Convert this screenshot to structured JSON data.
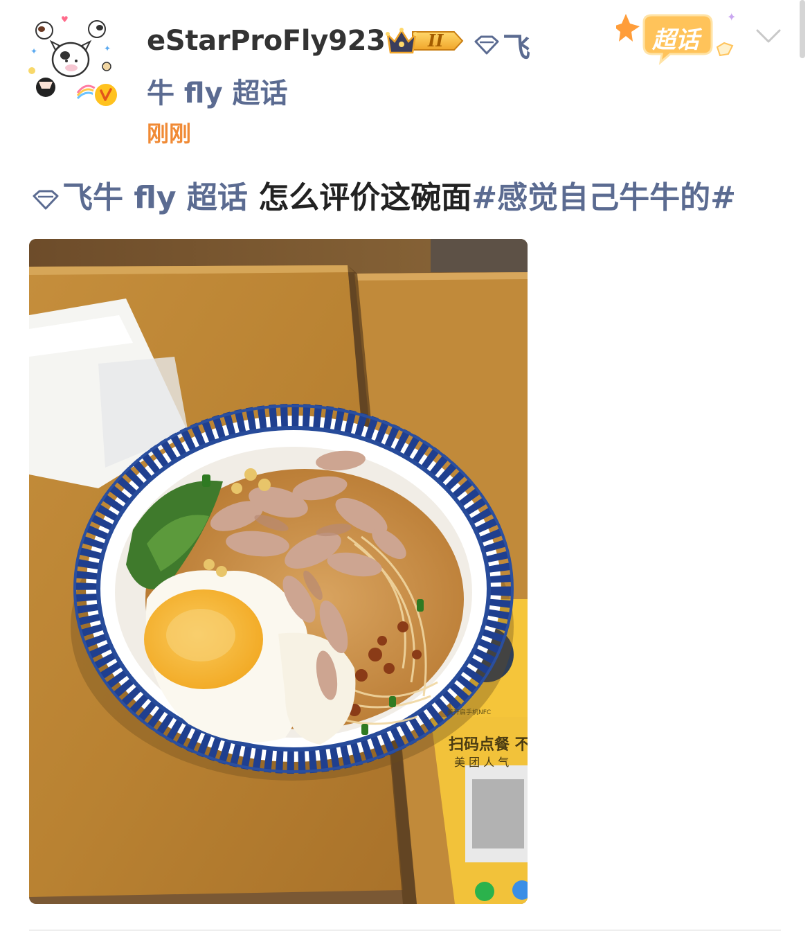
{
  "post": {
    "username": "eStarProFly923",
    "fan_level": "II",
    "topic_name_line1": "飞",
    "topic_name_line2": "牛 fly 超话",
    "timestamp": "刚刚",
    "supertopic_badge": "超话",
    "content": {
      "topic_link": "飞牛 fly 超话",
      "text": " 怎么评价这碗面",
      "hashtag": "#感觉自己牛牛的#"
    },
    "photo": {
      "nfc_text": "美开启手机NFC",
      "card_title": "扫码点餐 不",
      "card_subtitle": "美 团 人 气"
    }
  },
  "icons": {
    "topic": "diamond-topic-icon",
    "verified": "verified-v-icon",
    "crown": "crown-fan-badge-icon",
    "more": "chevron-down-icon"
  },
  "colors": {
    "topic_link": "#5b6b91",
    "timestamp": "#f08a35",
    "verified_badge": "#ffc21f",
    "supertopic_badge": "#ffb540"
  }
}
